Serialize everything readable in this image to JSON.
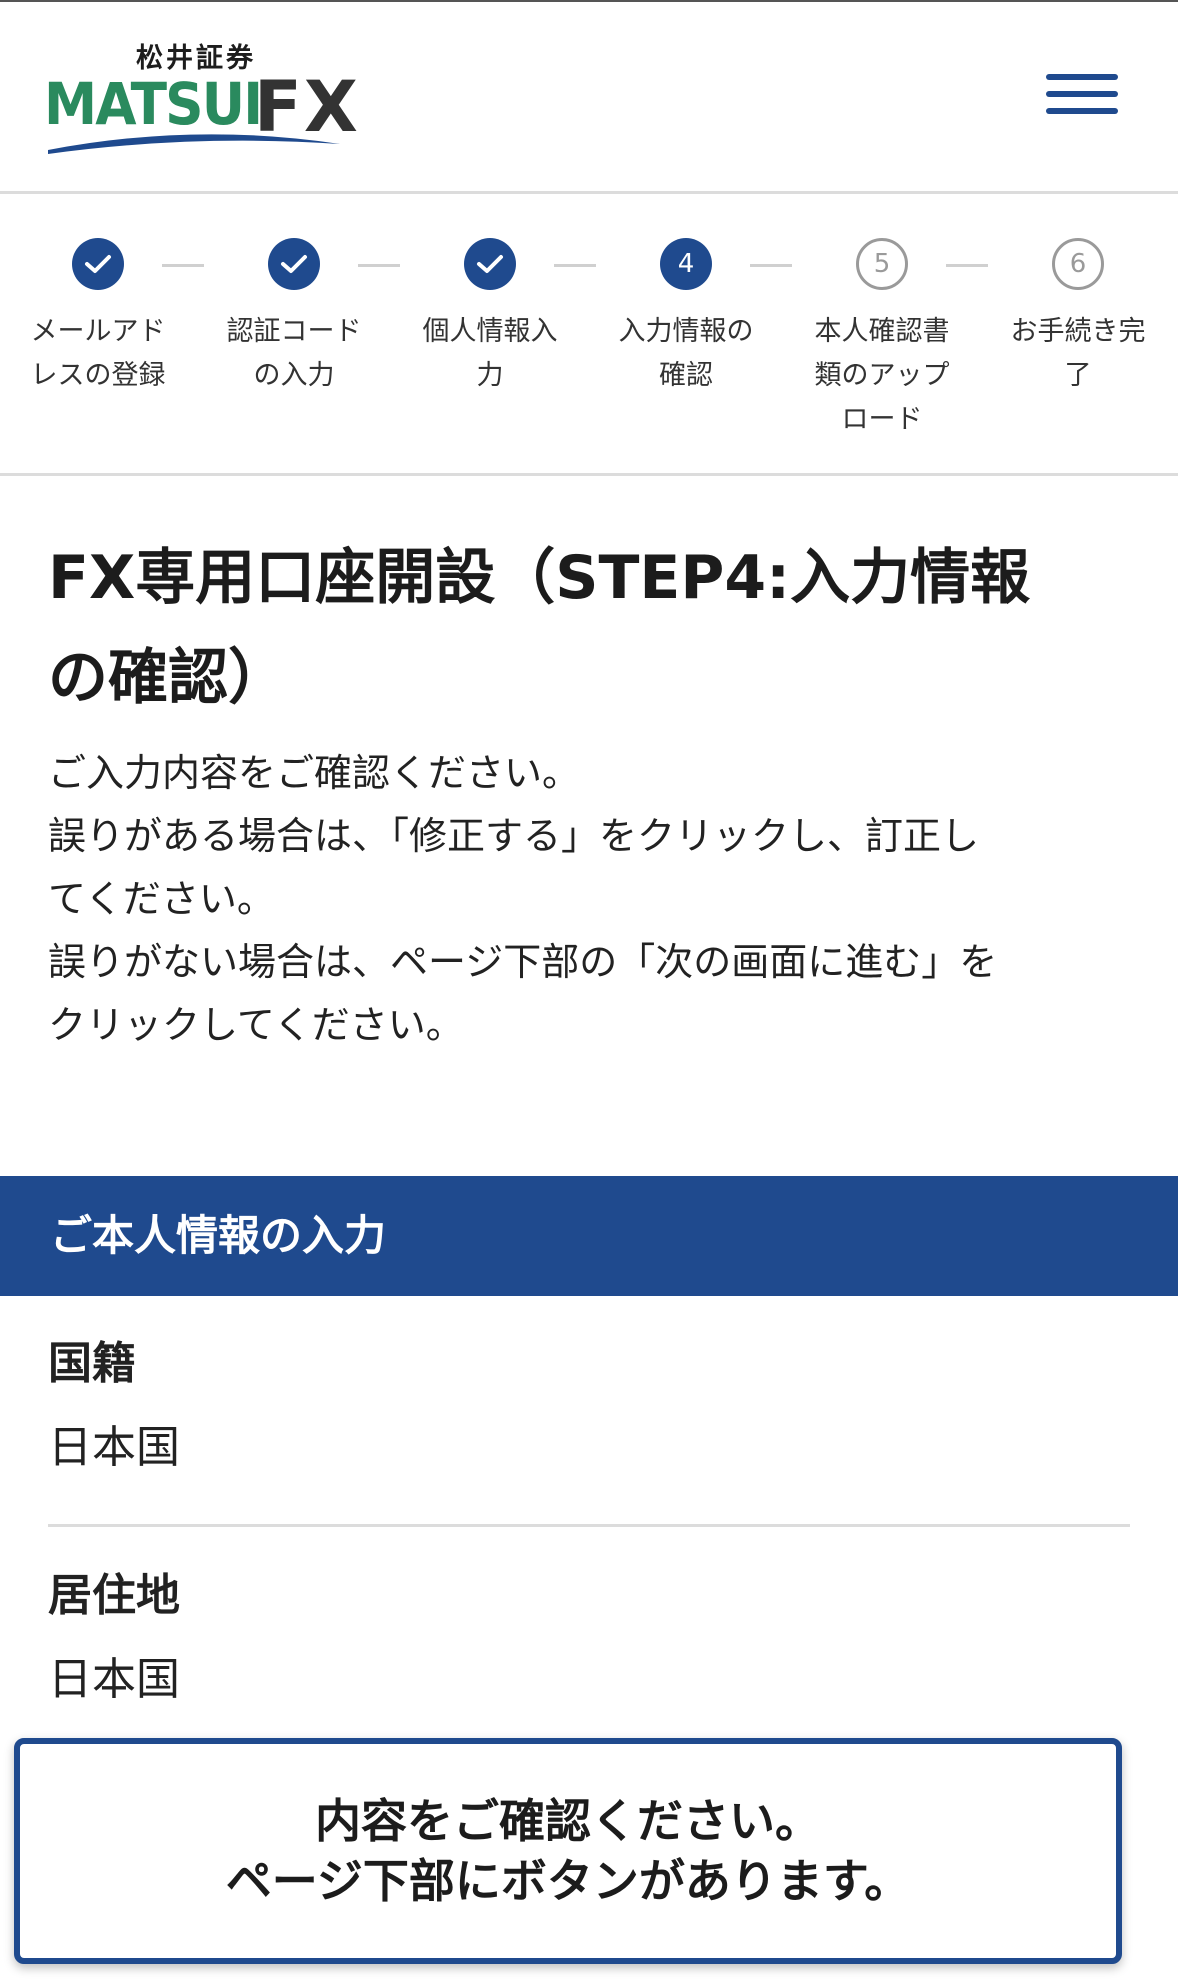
{
  "header": {
    "logo_kanji": "松井証券",
    "logo_matsui": "MATSUI",
    "logo_fx": "FX",
    "brand_green": "#2a8a5e",
    "brand_blue": "#1f4a8e"
  },
  "stepper": {
    "steps": [
      {
        "number": "1",
        "state": "done",
        "label_line1": "メールアド",
        "label_line2": "レスの登録",
        "label_line3": ""
      },
      {
        "number": "2",
        "state": "done",
        "label_line1": "認証コード",
        "label_line2": "の入力",
        "label_line3": ""
      },
      {
        "number": "3",
        "state": "done",
        "label_line1": "個人情報入",
        "label_line2": "力",
        "label_line3": ""
      },
      {
        "number": "4",
        "state": "current",
        "label_line1": "入力情報の",
        "label_line2": "確認",
        "label_line3": ""
      },
      {
        "number": "5",
        "state": "future",
        "label_line1": "本人確認書",
        "label_line2": "類のアップ",
        "label_line3": "ロード"
      },
      {
        "number": "6",
        "state": "future",
        "label_line1": "お手続き完",
        "label_line2": "了",
        "label_line3": ""
      }
    ]
  },
  "page": {
    "title_line1": "FX専用口座開設（STEP4:入力情報",
    "title_line2": "の確認）",
    "instructions": [
      "ご入力内容をご確認ください。",
      "誤りがある場合は、「修正する」をクリックし、訂正し",
      "てください。",
      "誤りがない場合は、ページ下部の「次の画面に進む」を",
      "クリックしてください。"
    ]
  },
  "section": {
    "title": "ご本人情報の入力",
    "fields": [
      {
        "label": "国籍",
        "value": "日本国"
      },
      {
        "label": "居住地",
        "value": "日本国"
      }
    ]
  },
  "notice": {
    "line1": "内容をご確認ください。",
    "line2": "ページ下部にボタンがあります。"
  }
}
